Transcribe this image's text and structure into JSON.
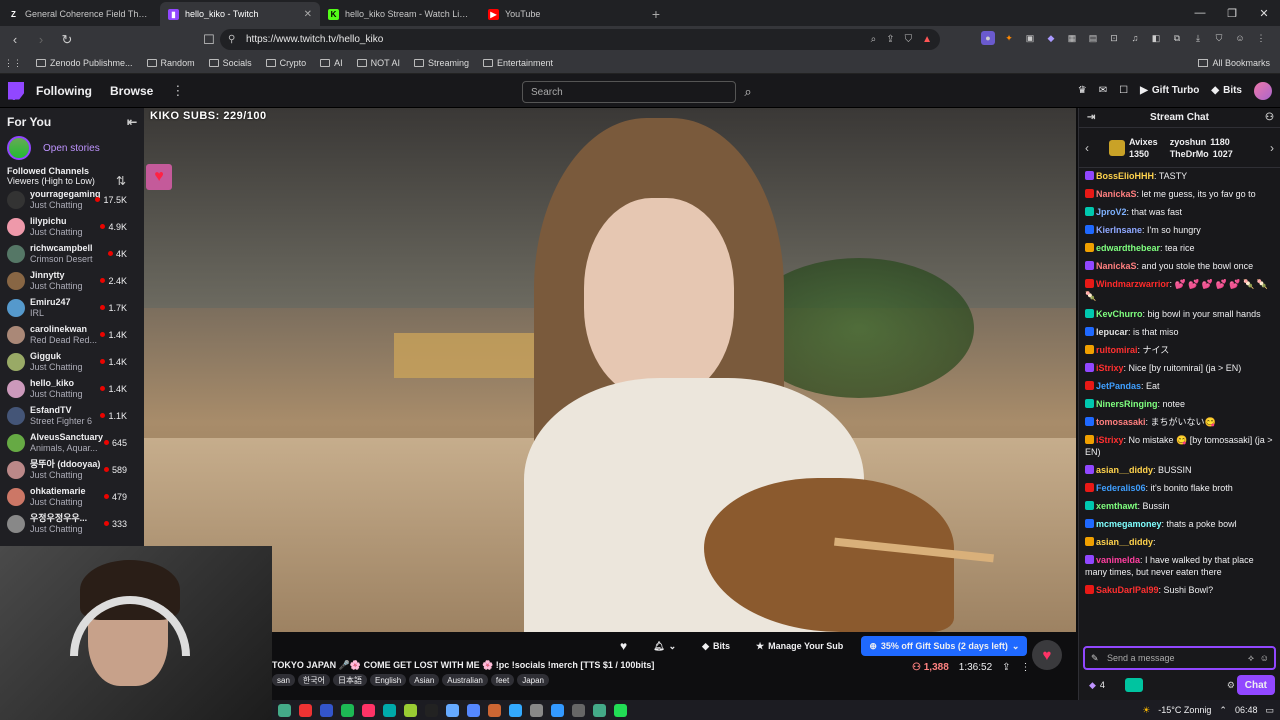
{
  "tabs": [
    {
      "title": "General Coherence Field Theory (GC",
      "icon": "zenodo-icon",
      "active": false
    },
    {
      "title": "hello_kiko - Twitch",
      "icon": "twitch-icon",
      "active": true
    },
    {
      "title": "hello_kiko Stream - Watch Live on",
      "icon": "kick-icon",
      "active": false
    },
    {
      "title": "YouTube",
      "icon": "youtube-icon",
      "active": false
    }
  ],
  "url": "https://www.twitch.tv/hello_kiko",
  "bookmarks": [
    "Zenodo Publishme...",
    "Random",
    "Socials",
    "Crypto",
    "AI",
    "NOT AI",
    "Streaming",
    "Entertainment"
  ],
  "all_bookmarks": "All Bookmarks",
  "twitch_nav": {
    "following": "Following",
    "browse": "Browse",
    "search_placeholder": "Search",
    "gift_turbo": "Gift Turbo",
    "bits": "Bits"
  },
  "sidebar": {
    "for_you": "For You",
    "open_stories": "Open stories",
    "followed": "Followed Channels",
    "sort": "Viewers (High to Low)",
    "channels": [
      {
        "name": "yourragegaming",
        "game": "Just Chatting",
        "viewers": "17.5K",
        "color": "#333"
      },
      {
        "name": "lilypichu",
        "game": "Just Chatting",
        "viewers": "4.9K",
        "color": "#e9a"
      },
      {
        "name": "richwcampbell",
        "game": "Crimson Desert",
        "viewers": "4K",
        "color": "#576"
      },
      {
        "name": "Jinnytty",
        "game": "Just Chatting",
        "viewers": "2.4K",
        "color": "#864"
      },
      {
        "name": "Emiru247",
        "game": "IRL",
        "viewers": "1.7K",
        "color": "#59c"
      },
      {
        "name": "carolinekwan",
        "game": "Red Dead Red...",
        "viewers": "1.4K",
        "color": "#a87"
      },
      {
        "name": "Gigguk",
        "game": "Just Chatting",
        "viewers": "1.4K",
        "color": "#9a6"
      },
      {
        "name": "hello_kiko",
        "game": "Just Chatting",
        "viewers": "1.4K",
        "color": "#c9b"
      },
      {
        "name": "EsfandTV",
        "game": "Street Fighter 6",
        "viewers": "1.1K",
        "color": "#457"
      },
      {
        "name": "AlveusSanctuary",
        "game": "Animals, Aquar...",
        "viewers": "645",
        "color": "#6a4"
      },
      {
        "name": "뭉뚜아 (ddooyaa)",
        "game": "Just Chatting",
        "viewers": "589",
        "color": "#b88"
      },
      {
        "name": "ohkatiemarie",
        "game": "Just Chatting",
        "viewers": "479",
        "color": "#c76"
      },
      {
        "name": "우정우정우우...",
        "game": "Just Chatting",
        "viewers": "333",
        "color": "#888"
      }
    ]
  },
  "video": {
    "subs_goal": "KIKO SUBS: 229/100"
  },
  "actions": {
    "bits": "Bits",
    "manage_sub": "Manage Your Sub",
    "gift_subs": "35% off Gift Subs (2 days left)"
  },
  "stream": {
    "title": "TOKYO JAPAN 🎤🌸 COME GET LOST WITH ME 🌸 !pc !socials !merch [TTS $1 / 100bits]",
    "tags": [
      "san",
      "한국어",
      "日本語",
      "English",
      "Asian",
      "Australian",
      "feet",
      "Japan"
    ],
    "viewers": "1,388",
    "uptime": "1:36:52"
  },
  "chat": {
    "header": "Stream Chat",
    "gifters": [
      {
        "name": "Avixes",
        "count": "1350"
      },
      {
        "name": "zyoshun",
        "count": "1180"
      },
      {
        "name": "TheDrMo",
        "count": "1027"
      }
    ],
    "messages": [
      {
        "user": "BossElioHHH",
        "color": "#ffd34d",
        "text": ": TASTY"
      },
      {
        "user": "NanickaS",
        "color": "#ff7f7f",
        "text": ": let me guess, its yo fav go to"
      },
      {
        "user": "JproV2",
        "color": "#7fb2ff",
        "text": ": that was fast"
      },
      {
        "user": "KierInsane",
        "color": "#8fa8ff",
        "text": ": I'm so hungry"
      },
      {
        "user": "edwardthebear",
        "color": "#7fff7f",
        "text": ": tea rice"
      },
      {
        "user": "NanickaS",
        "color": "#ff7f7f",
        "text": ": and you stole the bowl once"
      },
      {
        "user": "Windmarzwarrior",
        "color": "#ff2a2a",
        "text": ": 💕 💕 💕 💕 💕 🍡 🍡 🍡"
      },
      {
        "user": "KevChurro",
        "color": "#7fff7f",
        "text": ": big bowl in your small hands"
      },
      {
        "user": "lepucar",
        "color": "#e0e0e0",
        "text": ": is that miso"
      },
      {
        "user": "rultomirai",
        "color": "#ff3030",
        "text": ": ナイス"
      },
      {
        "user": "iStrixy",
        "color": "#ff3030",
        "text": ": Nice [by ruitomirai] (ja > EN)"
      },
      {
        "user": "JetPandas",
        "color": "#3f9fff",
        "text": ": Eat"
      },
      {
        "user": "NinersRinging",
        "color": "#7fff7f",
        "text": ": notee"
      },
      {
        "user": "tomosasaki",
        "color": "#ff7f7f",
        "text": ": まちがいない😋"
      },
      {
        "user": "iStrixy",
        "color": "#ff3030",
        "text": ": No mistake 😋 [by tomosasaki] (ja > EN)"
      },
      {
        "user": "asian__diddy",
        "color": "#ffd34d",
        "text": ": BUSSIN"
      },
      {
        "user": "Federalis06",
        "color": "#3f9fff",
        "text": ": it's bonito flake broth"
      },
      {
        "user": "xemthawt",
        "color": "#7fff7f",
        "text": ": Bussin"
      },
      {
        "user": "mcmegamoney",
        "color": "#7fffff",
        "text": ": thats a poke bowl"
      },
      {
        "user": "asian__diddy",
        "color": "#ffd34d",
        "text": ":"
      },
      {
        "user": "vanimelda",
        "color": "#ff3fa0",
        "text": ": I have walked by that place many times, but never eaten there"
      },
      {
        "user": "SakuDarlPal99",
        "color": "#ff3030",
        "text": ": Sushi Bowl?"
      }
    ],
    "input_placeholder": "Send a message",
    "points": "4",
    "chat_button": "Chat"
  },
  "taskbar": {
    "weather": "-15°C  Zonnig",
    "time": "06:48"
  }
}
